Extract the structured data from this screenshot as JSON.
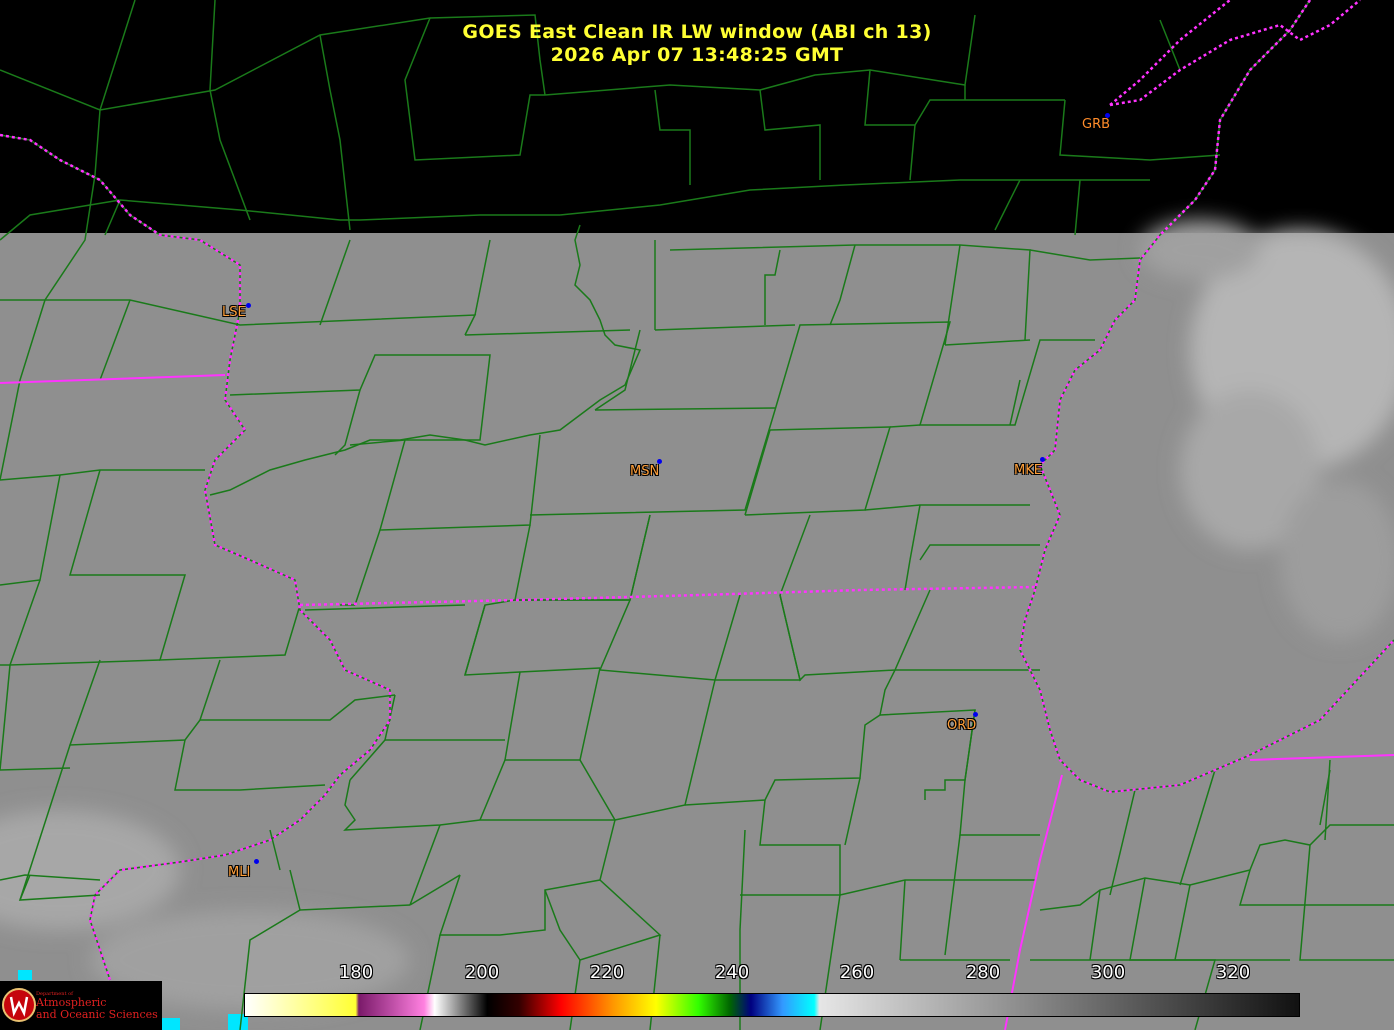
{
  "title": {
    "line1": "GOES East Clean IR LW window (ABI ch 13)",
    "line2": "2026 Apr 07  13:48:25 GMT"
  },
  "stations": [
    {
      "id": "GRB",
      "outlined": false
    },
    {
      "id": "LSE",
      "outlined": true
    },
    {
      "id": "MSN",
      "outlined": true
    },
    {
      "id": "MKE",
      "outlined": true
    },
    {
      "id": "ORD",
      "outlined": true
    },
    {
      "id": "MLI",
      "outlined": true
    }
  ],
  "colorbar": {
    "ticks": [
      "180",
      "200",
      "220",
      "240",
      "260",
      "280",
      "300",
      "320"
    ],
    "colors": {
      "yellow": "#ffff33",
      "magenta": "#d040c0",
      "pink": "#ff80e0",
      "red": "#ff0000",
      "orange": "#ff9900",
      "green": "#33ff00",
      "navy": "#000080",
      "cyan": "#00ffff",
      "gray_warm": "#111111"
    }
  },
  "map": {
    "background": "#000000",
    "cloud_free_gray": "#8f8f8f",
    "county_line_color": "#1a7a1a",
    "state_border_color": "#ff33ff"
  },
  "logo": {
    "dept": "Department of",
    "line1": "Atmospheric",
    "line2": "and Oceanic Sciences"
  }
}
